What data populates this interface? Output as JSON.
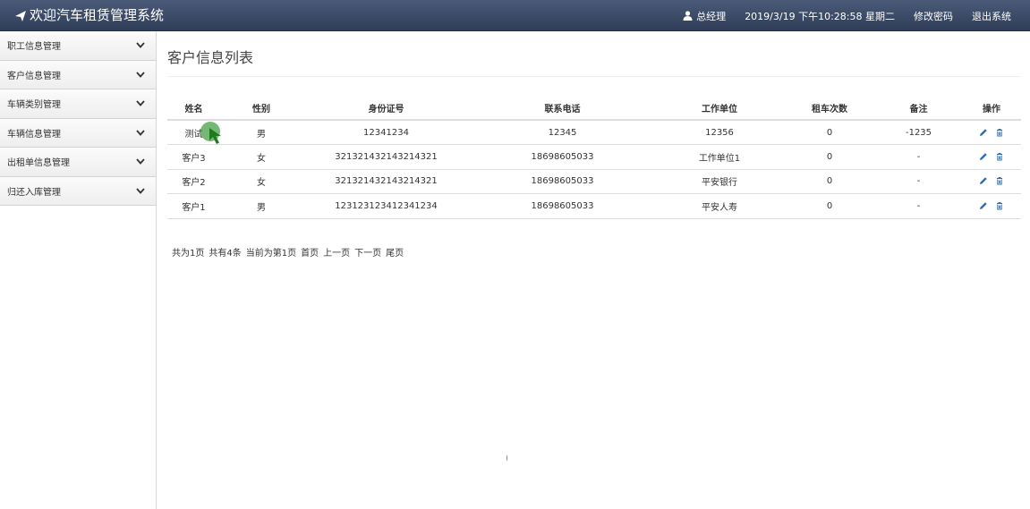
{
  "app": {
    "title": "欢迎汽车租赁管理系统"
  },
  "topbar": {
    "user_label": "总经理",
    "datetime": "2019/3/19 下午10:28:58 星期二",
    "change_password": "修改密码",
    "logout": "退出系统"
  },
  "sidebar": {
    "items": [
      {
        "label": "职工信息管理"
      },
      {
        "label": "客户信息管理"
      },
      {
        "label": "车辆类别管理"
      },
      {
        "label": "车辆信息管理"
      },
      {
        "label": "出租单信息管理"
      },
      {
        "label": "归还入库管理"
      }
    ]
  },
  "main": {
    "page_title": "客户信息列表",
    "table": {
      "headers": [
        "姓名",
        "性别",
        "身份证号",
        "联系电话",
        "工作单位",
        "租车次数",
        "备注",
        "操作"
      ],
      "rows": [
        [
          "测试",
          "男",
          "12341234",
          "12345",
          "12356",
          "0",
          "-1235"
        ],
        [
          "客户3",
          "女",
          "321321432143214321",
          "18698605033",
          "工作单位1",
          "0",
          "-"
        ],
        [
          "客户2",
          "女",
          "321321432143214321",
          "18698605033",
          "平安银行",
          "0",
          "-"
        ],
        [
          "客户1",
          "男",
          "123123123412341234",
          "18698605033",
          "平安人寿",
          "0",
          "-"
        ]
      ]
    },
    "pager": {
      "total_pages": "共为1页",
      "total_items": "共有4条",
      "current_page": "当前为第1页",
      "first": "首页",
      "prev": "上一页",
      "next": "下一页",
      "last": "尾页"
    }
  },
  "colors": {
    "topbar": "#3b4a68",
    "icon_blue": "#2a6db5",
    "cursor_green": "#1f7a1f"
  },
  "icons": {
    "brand": "paper-plane-icon",
    "user": "user-icon",
    "chevron": "chevron-down-icon",
    "edit": "pencil-icon",
    "delete": "trash-icon"
  }
}
